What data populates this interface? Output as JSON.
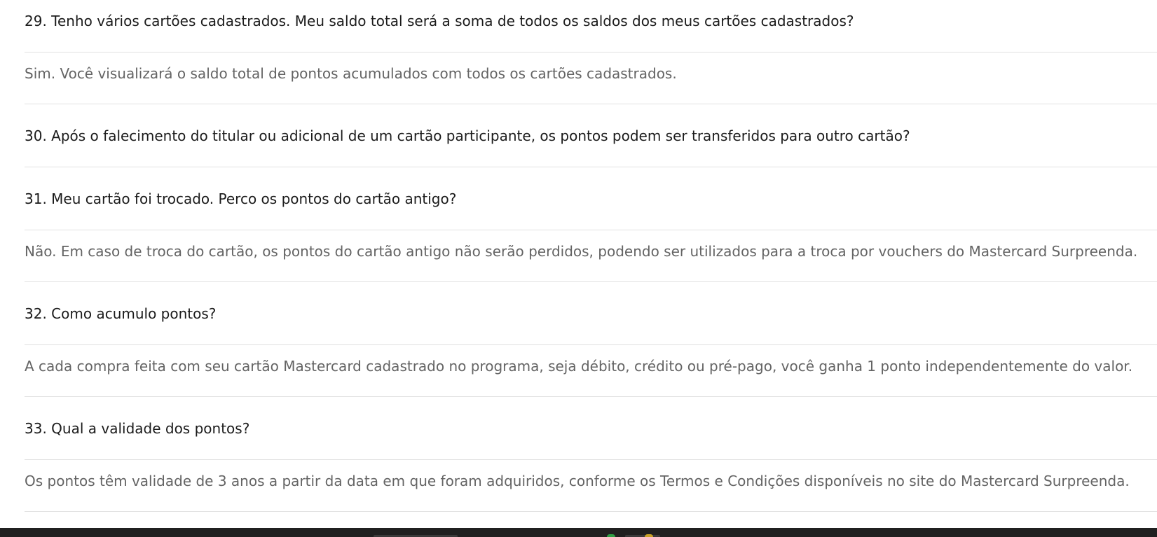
{
  "faq": [
    {
      "question": "29. Tenho vários cartões cadastrados. Meu saldo total será a soma de todos os saldos dos meus cartões cadastrados?",
      "answer": "Sim. Você visualizará o saldo total de pontos acumulados com todos os cartões cadastrados."
    },
    {
      "question": "30. Após o falecimento do titular ou adicional de um cartão participante, os pontos podem ser transferidos para outro cartão?",
      "answer": null
    },
    {
      "question": "31. Meu cartão foi trocado. Perco os pontos do cartão antigo?",
      "answer": "Não. Em caso de troca do cartão, os pontos do cartão antigo não serão perdidos, podendo ser utilizados para a troca por vouchers do Mastercard Surpreenda."
    },
    {
      "question": "32. Como acumulo pontos?",
      "answer": "A cada compra feita com seu cartão Mastercard cadastrado no programa, seja débito, crédito ou pré-pago, você ganha 1 ponto independentemente do valor."
    },
    {
      "question": "33. Qual a validade dos pontos?",
      "answer": "Os pontos têm validade de 3 anos a partir da data em que foram adquiridos, conforme os Termos e Condições disponíveis no site do Mastercard Surpreenda."
    }
  ],
  "colors": {
    "question_text": "#1b1b1b",
    "answer_text": "#646464",
    "divider": "#e1e1e1",
    "taskbar": "#202020"
  }
}
